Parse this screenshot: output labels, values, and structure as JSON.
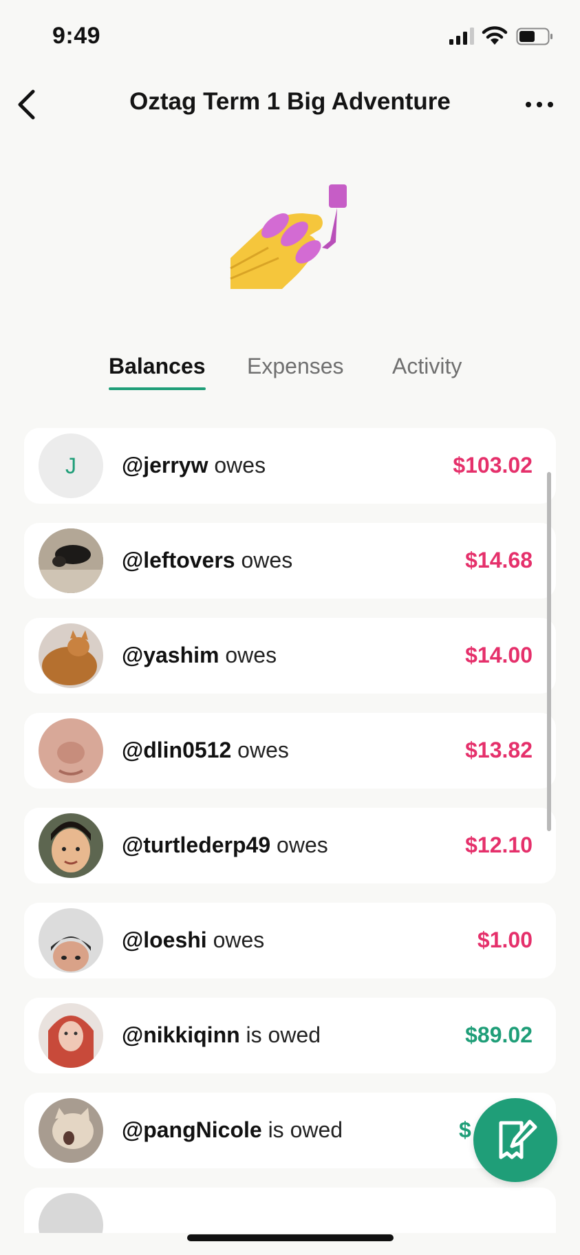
{
  "status_bar": {
    "time": "9:49"
  },
  "header": {
    "title": "Oztag Term 1 Big Adventure"
  },
  "group_icon": "nail-polish-emoji",
  "tabs": [
    {
      "label": "Balances",
      "active": true
    },
    {
      "label": "Expenses",
      "active": false
    },
    {
      "label": "Activity",
      "active": false
    }
  ],
  "balances": [
    {
      "username": "@jerryw",
      "verb": "owes",
      "amount": "$103.02",
      "status": "owes",
      "avatar_initial": "J"
    },
    {
      "username": "@leftovers",
      "verb": "owes",
      "amount": "$14.68",
      "status": "owes"
    },
    {
      "username": "@yashim",
      "verb": "owes",
      "amount": "$14.00",
      "status": "owes"
    },
    {
      "username": "@dlin0512",
      "verb": "owes",
      "amount": "$13.82",
      "status": "owes"
    },
    {
      "username": "@turtlederp49",
      "verb": "owes",
      "amount": "$12.10",
      "status": "owes"
    },
    {
      "username": "@loeshi",
      "verb": "owes",
      "amount": "$1.00",
      "status": "owes"
    },
    {
      "username": "@nikkiqinn",
      "verb": "is owed",
      "amount": "$89.02",
      "status": "owed"
    },
    {
      "username": "@pangNicole",
      "verb": "is owed",
      "amount": "$",
      "status": "owed"
    }
  ],
  "colors": {
    "accent": "#1f9e78",
    "owes": "#e5306b",
    "owed": "#1f9e78"
  }
}
